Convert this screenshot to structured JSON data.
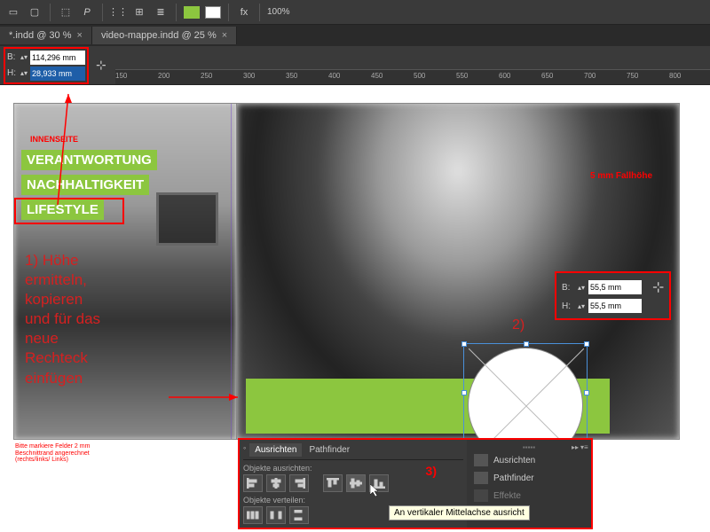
{
  "toolbar": {
    "zoom": "100%"
  },
  "tabs": [
    {
      "label": "*.indd @ 30 %",
      "active": false
    },
    {
      "label": "video-mappe.indd @ 25 %",
      "active": true
    }
  ],
  "bh_top": {
    "b_label": "B:",
    "h_label": "H:",
    "b_val": "114,296 mm",
    "h_val": "28,933 mm"
  },
  "ruler": {
    "ticks": [
      "150",
      "200",
      "250",
      "300",
      "350",
      "400",
      "450",
      "500",
      "550",
      "600",
      "650",
      "700",
      "750",
      "800"
    ]
  },
  "page": {
    "corner": "INNENSEITE",
    "bars": [
      "VERANTWORTUNG",
      "NACHHALTIGKEIT",
      "LIFESTYLE"
    ],
    "fallhohe": "5 mm Fallhöhe",
    "annot": "1) Höhe\nermitteln,\nkopieren\nund für das\nneue\nRechteck\neinfügen",
    "step2": "2)",
    "step3": "3)",
    "caption": "Bitte markiere Felder 2 mm\nBeschnittrand angerechnet\n(rechts/links/ Links)"
  },
  "float_bh": {
    "b": "B:",
    "h": "H:",
    "b_val": "55,5 mm",
    "h_val": "55,5 mm"
  },
  "align": {
    "tabs": [
      "Ausrichten",
      "Pathfinder"
    ],
    "sect1": "Objekte ausrichten:",
    "sect2": "Objekte verteilen:",
    "side": [
      "Ausrichten",
      "Pathfinder",
      "Effekte"
    ],
    "tooltip": "An vertikaler Mittelachse ausricht"
  }
}
